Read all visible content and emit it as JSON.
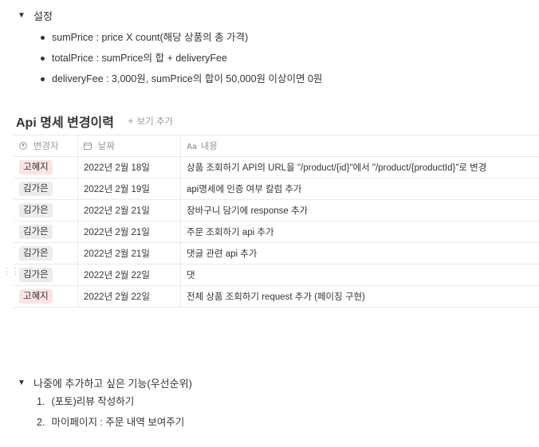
{
  "settings_toggle": {
    "label": "설정",
    "items": [
      "sumPrice : price X count(해당 상품의 총 가격)",
      "totalPrice : sumPrice의 합 + deliveryFee",
      "deliveryFee : 3,000원, sumPrice의 합이 50,000원 이상이면 0원"
    ]
  },
  "database": {
    "title": "Api 명세 변경이력",
    "add_view_label": "보기 추가",
    "columns": [
      {
        "label": "변경자",
        "icon": "person-icon"
      },
      {
        "label": "날짜",
        "icon": "calendar-icon"
      },
      {
        "label": "내용",
        "icon": "text-icon"
      }
    ],
    "rows": [
      {
        "author": "고혜지",
        "tag_color": "#fbe4e4",
        "date": "2022년 2월 18일",
        "content": "상품 조회하기 API의 URL을 \"/product/{id}\"에서 \"/product/{productId}\"로 변경"
      },
      {
        "author": "김가은",
        "tag_color": "#ebeced",
        "date": "2022년 2월 19일",
        "content": "api명세에 인증 여부 칼럼 추가"
      },
      {
        "author": "김가은",
        "tag_color": "#ebeced",
        "date": "2022년 2월 21일",
        "content": "장바구니 담기에 response 추가"
      },
      {
        "author": "김가은",
        "tag_color": "#ebeced",
        "date": "2022년 2월 21일",
        "content": "주문 조회하기 api 추가"
      },
      {
        "author": "김가은",
        "tag_color": "#ebeced",
        "date": "2022년 2월 21일",
        "content": "댓글 관련 api 추가"
      },
      {
        "author": "김가은",
        "tag_color": "#ebeced",
        "date": "2022년 2월 22일",
        "content": "댓"
      },
      {
        "author": "고혜지",
        "tag_color": "#fbe4e4",
        "date": "2022년 2월 22일",
        "content": "전체 상품 조회하기 request 추가 (페이징 구현)"
      }
    ]
  },
  "future_toggle": {
    "label": "나중에 추가하고 싶은 기능(우선순위)",
    "items": [
      {
        "num": "1.",
        "text": "(포토)리뷰 작성하기"
      },
      {
        "num": "2.",
        "text": "마이페이지 : 주문 내역 보여주기"
      }
    ]
  }
}
